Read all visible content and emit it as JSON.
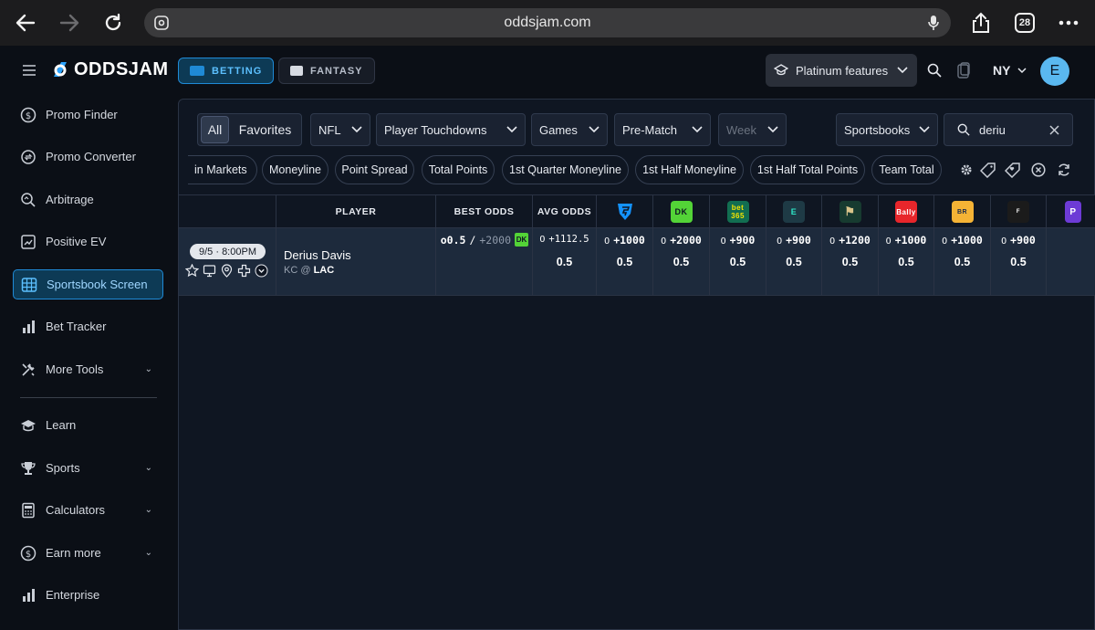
{
  "browser": {
    "url": "oddsjam.com",
    "tab_count": "28"
  },
  "brand": {
    "name": "ODDSJAM"
  },
  "topnav": {
    "betting_label": "BETTING",
    "fantasy_label": "FANTASY",
    "platinum_label": "Platinum features",
    "region": "NY",
    "avatar_letter": "E"
  },
  "sidebar": {
    "items": [
      {
        "label": "Promo Finder"
      },
      {
        "label": "Promo Converter"
      },
      {
        "label": "Arbitrage"
      },
      {
        "label": "Positive EV"
      },
      {
        "label": "Sportsbook Screen"
      },
      {
        "label": "Bet Tracker"
      },
      {
        "label": "More Tools"
      },
      {
        "label": "Learn"
      },
      {
        "label": "Sports"
      },
      {
        "label": "Calculators"
      },
      {
        "label": "Earn more"
      },
      {
        "label": "Enterprise"
      }
    ]
  },
  "filters": {
    "all_label": "All",
    "favorites_label": "Favorites",
    "league": "NFL",
    "market": "Player Touchdowns",
    "games": "Games",
    "timing": "Pre-Match",
    "week_placeholder": "Week",
    "sportsbooks": "Sportsbooks",
    "search_value": "deriu"
  },
  "chips": [
    "in Markets",
    "Moneyline",
    "Point Spread",
    "Total Points",
    "1st Quarter Moneyline",
    "1st Half Moneyline",
    "1st Half Total Points",
    "Team Total"
  ],
  "table": {
    "headers": {
      "player": "PLAYER",
      "best_odds": "BEST ODDS",
      "avg_odds": "AVG ODDS"
    },
    "books": [
      {
        "name": "fanduel-logo",
        "color": "#1493ff"
      },
      {
        "name": "draftkings-logo",
        "color": "#53d337"
      },
      {
        "name": "bet365-logo",
        "color": "#126e51"
      },
      {
        "name": "espnbet-logo",
        "color": "#1e3a45"
      },
      {
        "name": "caesars-logo",
        "color": "#173b30"
      },
      {
        "name": "ballybet-logo",
        "color": "#e8262b"
      },
      {
        "name": "betrivers-logo",
        "color": "#f5b335"
      },
      {
        "name": "fanatics-logo",
        "color": "#1b1b1b"
      },
      {
        "name": "partial-book-logo",
        "color": "#6d3bd6"
      }
    ],
    "row": {
      "time": "9/5 · 8:00PM",
      "player": "Derius Davis",
      "team": "KC",
      "at": "@",
      "opponent": "LAC",
      "best_odds_line": "o0.5",
      "best_odds_sep": "/",
      "best_odds_price": "+2000",
      "avg_prefix": "O",
      "avg_price": "+1112.5",
      "avg_line": "0.5",
      "book_odds": [
        {
          "prefix": "O",
          "price": "+1000",
          "line": "0.5"
        },
        {
          "prefix": "O",
          "price": "+2000",
          "line": "0.5"
        },
        {
          "prefix": "O",
          "price": "+900",
          "line": "0.5"
        },
        {
          "prefix": "O",
          "price": "+900",
          "line": "0.5"
        },
        {
          "prefix": "O",
          "price": "+1200",
          "line": "0.5"
        },
        {
          "prefix": "O",
          "price": "+1000",
          "line": "0.5"
        },
        {
          "prefix": "O",
          "price": "+1000",
          "line": "0.5"
        },
        {
          "prefix": "O",
          "price": "+900",
          "line": "0.5"
        }
      ]
    }
  }
}
